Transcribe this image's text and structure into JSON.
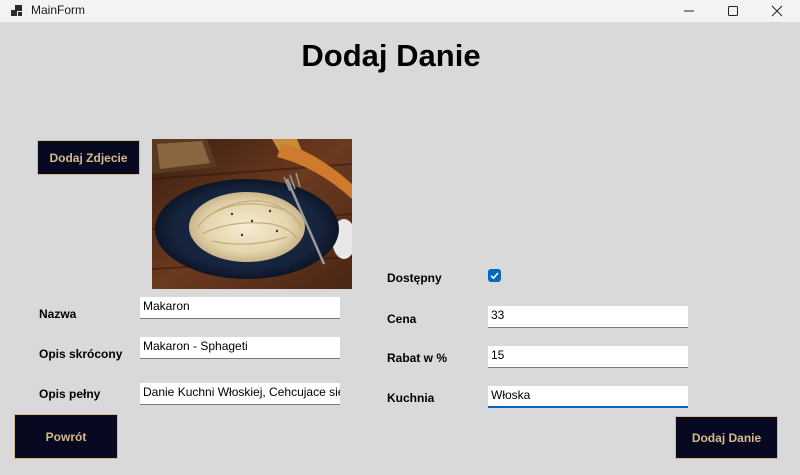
{
  "window": {
    "title": "MainForm"
  },
  "heading": "Dodaj Danie",
  "buttons": {
    "add_photo": "Dodaj Zdjecie",
    "back": "Powrót",
    "add_dish": "Dodaj Danie"
  },
  "fields": {
    "name": {
      "label": "Nazwa",
      "value": "Makaron"
    },
    "short_desc": {
      "label": "Opis skrócony",
      "value": "Makaron - Sphageti"
    },
    "full_desc": {
      "label": "Opis pełny",
      "value": "Danie Kuchni Włoskiej, Cehcujace się"
    },
    "available": {
      "label": "Dostępny",
      "checked": true
    },
    "price": {
      "label": "Cena",
      "value": "33"
    },
    "discount": {
      "label": "Rabat w %",
      "value": "15"
    },
    "cuisine": {
      "label": "Kuchnia",
      "value": "Włoska"
    }
  },
  "colors": {
    "button_bg": "#06091f",
    "button_text": "#d8b98a",
    "accent": "#0067c0",
    "form_bg": "#d9d9d9"
  },
  "icons": {
    "app": "app-window-icon",
    "minimize": "minimize-icon",
    "maximize": "maximize-icon",
    "close": "close-icon",
    "check": "check-icon"
  }
}
